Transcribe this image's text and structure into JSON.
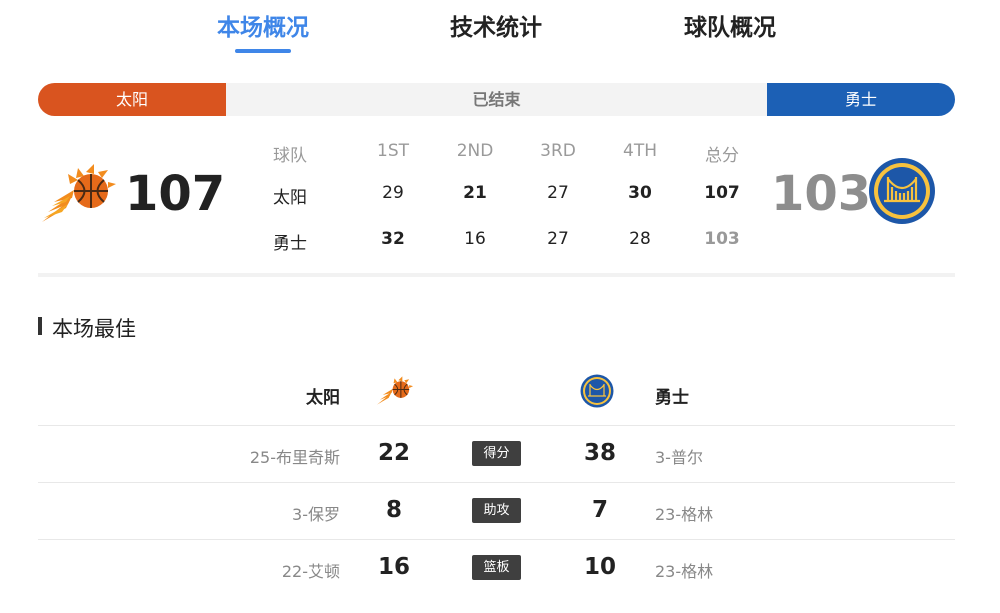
{
  "tabs": [
    {
      "label": "本场概况",
      "active": true
    },
    {
      "label": "技术统计",
      "active": false
    },
    {
      "label": "球队概况",
      "active": false
    }
  ],
  "status": {
    "home_name": "太阳",
    "status_text": "已结束",
    "away_name": "勇士"
  },
  "colors": {
    "accent": "#3f86e8",
    "home": "#d9541f",
    "away": "#1c60b5"
  },
  "score": {
    "home": "107",
    "away": "103"
  },
  "quarters": {
    "headers": [
      "球队",
      "1ST",
      "2ND",
      "3RD",
      "4TH",
      "总分"
    ],
    "rows": [
      {
        "team": "太阳",
        "q": [
          "29",
          "21",
          "27",
          "30"
        ],
        "total": "107"
      },
      {
        "team": "勇士",
        "q": [
          "32",
          "16",
          "27",
          "28"
        ],
        "total": "103"
      }
    ]
  },
  "best": {
    "title": "本场最佳",
    "home_name": "太阳",
    "away_name": "勇士",
    "rows": [
      {
        "home_player": "25-布里奇斯",
        "home_value": "22",
        "stat": "得分",
        "away_value": "38",
        "away_player": "3-普尔"
      },
      {
        "home_player": "3-保罗",
        "home_value": "8",
        "stat": "助攻",
        "away_value": "7",
        "away_player": "23-格林"
      },
      {
        "home_player": "22-艾顿",
        "home_value": "16",
        "stat": "篮板",
        "away_value": "10",
        "away_player": "23-格林"
      }
    ]
  },
  "icons": {
    "home_logo": "phoenix-suns-logo",
    "away_logo": "golden-state-warriors-logo"
  }
}
